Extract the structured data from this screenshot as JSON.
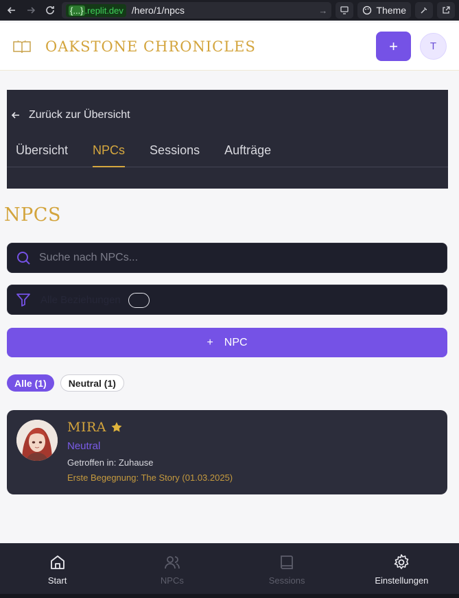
{
  "browser": {
    "url_domain_brace": "{...}",
    "url_domain": ".replit.dev",
    "url_path": "/hero/1/npcs",
    "theme_label": "Theme"
  },
  "header": {
    "title": "OAKSTONE CHRONICLES",
    "add_label": "+",
    "avatar_initial": "T"
  },
  "subnav": {
    "back_label": "Zurück zur Übersicht",
    "tabs": [
      {
        "label": "Übersicht"
      },
      {
        "label": "NPCs"
      },
      {
        "label": "Sessions"
      },
      {
        "label": "Aufträge"
      }
    ],
    "active_tab": "NPCs"
  },
  "page": {
    "title": "NPCS",
    "search_placeholder": "Suche nach NPCs...",
    "filter_text": "Alle Beziehungen",
    "add_npc_label": "NPC",
    "filters": [
      {
        "label": "Alle (1)",
        "active": true
      },
      {
        "label": "Neutral (1)",
        "active": false
      }
    ]
  },
  "npcs": [
    {
      "name": "MIRA",
      "favorite": true,
      "relation": "Neutral",
      "met_in": "Getroffen in: Zuhause",
      "first_meeting": "Erste Begegnung: The Story (01.03.2025)"
    }
  ],
  "bottom_nav": [
    {
      "label": "Start",
      "icon": "home-icon",
      "active": true
    },
    {
      "label": "NPCs",
      "icon": "users-icon",
      "active": false
    },
    {
      "label": "Sessions",
      "icon": "book-icon",
      "active": false
    },
    {
      "label": "Einstellungen",
      "icon": "gear-icon",
      "active": true
    }
  ],
  "colors": {
    "accent": "#7552e6",
    "gold": "#d3a43c",
    "dark": "#292a37"
  }
}
